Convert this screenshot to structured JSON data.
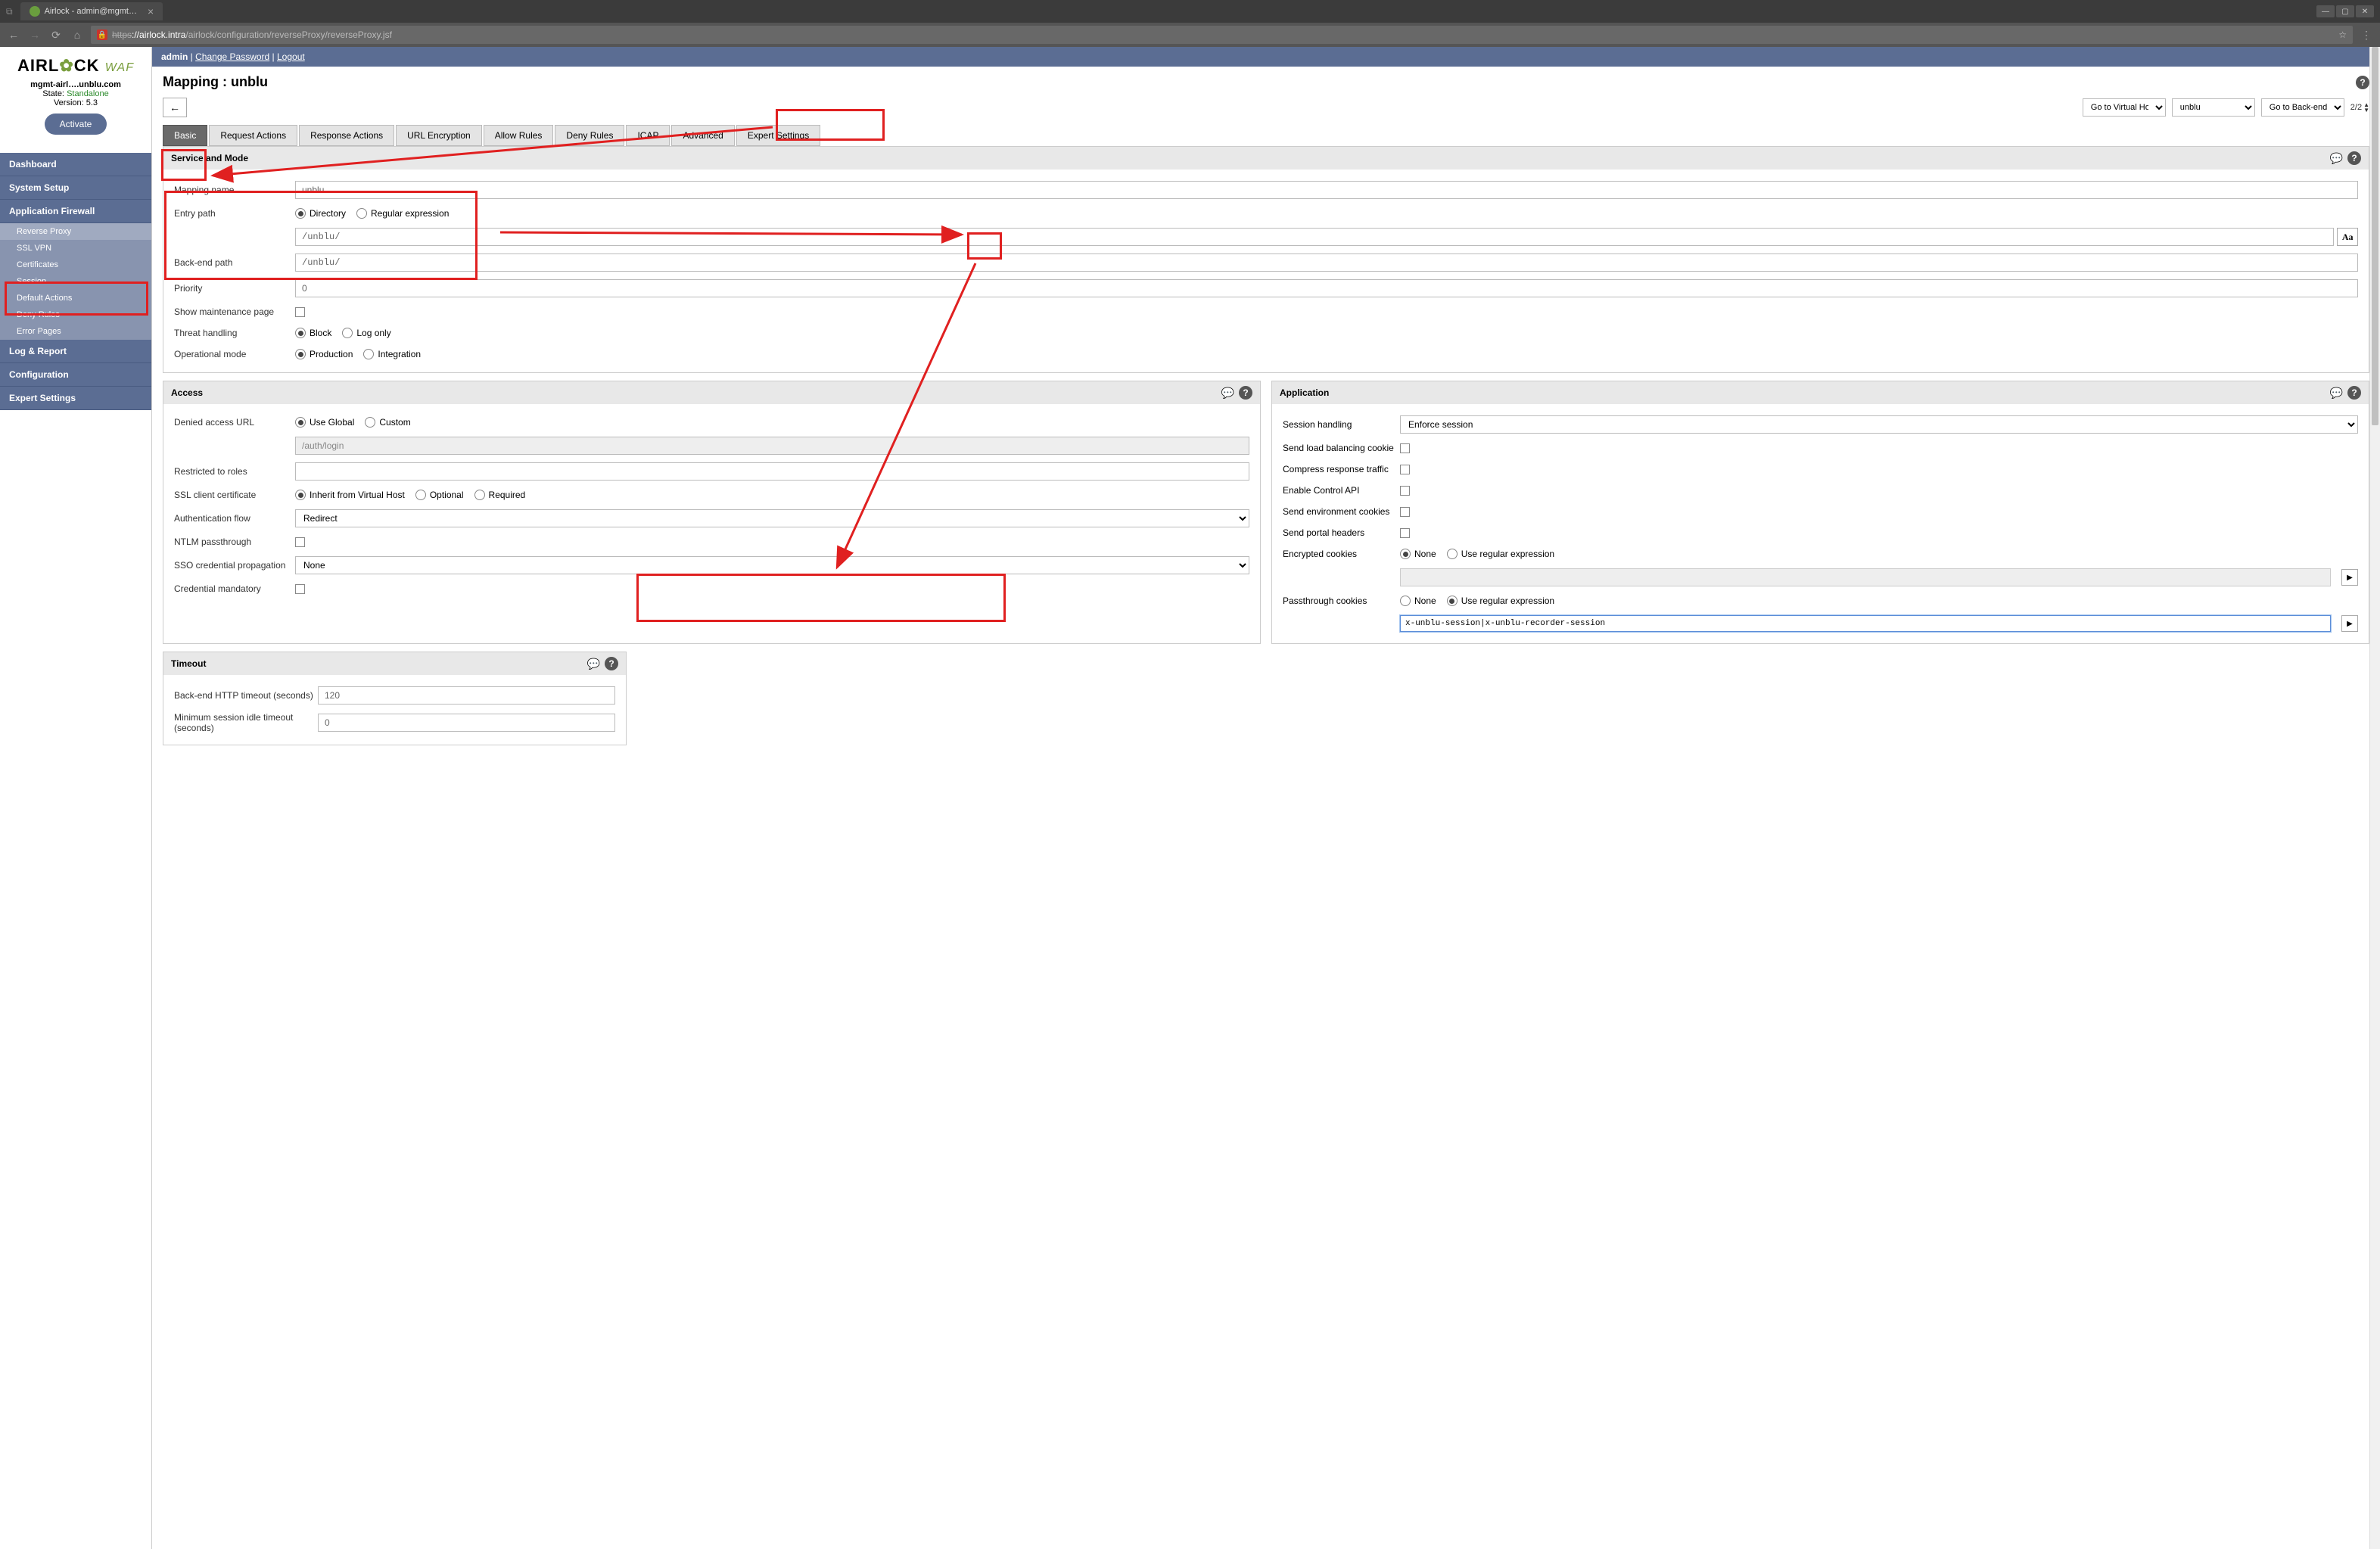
{
  "browser": {
    "tab_title": "Airlock - admin@mgmt…",
    "url_prefix": "https",
    "url_domain": "://airlock.intra",
    "url_path": "/airlock/configuration/reverseProxy/reverseProxy.jsf"
  },
  "logo": {
    "brand": "AIRL",
    "brand2": "CK",
    "waf": "WAF"
  },
  "host": {
    "name": "mgmt-airl….unblu.com",
    "state_label": "State:",
    "state_value": "Standalone",
    "version_label": "Version:",
    "version_value": "5.3"
  },
  "activate": "Activate",
  "nav": {
    "dashboard": "Dashboard",
    "system_setup": "System Setup",
    "app_firewall": "Application Firewall",
    "reverse_proxy": "Reverse Proxy",
    "ssl_vpn": "SSL VPN",
    "certificates": "Certificates",
    "session": "Session",
    "default_actions": "Default Actions",
    "deny_rules": "Deny Rules",
    "error_pages": "Error Pages",
    "log_report": "Log & Report",
    "configuration": "Configuration",
    "expert": "Expert Settings"
  },
  "topbar": {
    "user": "admin",
    "change_pw": "Change Password",
    "logout": "Logout"
  },
  "page_title": "Mapping : unblu",
  "toolbar": {
    "back": "←",
    "vh_label": "Go to Virtual Host",
    "mapping_value": "unblu",
    "bg_label": "Go to Back-end Gr",
    "pager": "2/2"
  },
  "tabs": {
    "basic": "Basic",
    "request": "Request Actions",
    "response": "Response Actions",
    "url_enc": "URL Encryption",
    "allow": "Allow Rules",
    "deny": "Deny Rules",
    "icap": "ICAP",
    "advanced": "Advanced",
    "expert": "Expert Settings"
  },
  "service": {
    "header": "Service and Mode",
    "mapping_name_label": "Mapping name",
    "mapping_name_value": "unblu",
    "entry_path_label": "Entry path",
    "directory": "Directory",
    "regex": "Regular expression",
    "entry_path_value": "/unblu/",
    "backend_label": "Back-end path",
    "backend_value": "/unblu/",
    "priority_label": "Priority",
    "priority_value": "0",
    "maintenance_label": "Show maintenance page",
    "threat_label": "Threat handling",
    "block": "Block",
    "logonly": "Log only",
    "opmode_label": "Operational mode",
    "production": "Production",
    "integration": "Integration",
    "aa": "Aa"
  },
  "access": {
    "header": "Access",
    "denied_url_label": "Denied access URL",
    "use_global": "Use Global",
    "custom": "Custom",
    "denied_url_value": "/auth/login",
    "restricted_label": "Restricted to roles",
    "ssl_label": "SSL client certificate",
    "inherit": "Inherit from Virtual Host",
    "optional": "Optional",
    "required": "Required",
    "auth_flow_label": "Authentication flow",
    "auth_flow_value": "Redirect",
    "ntlm_label": "NTLM passthrough",
    "sso_label": "SSO credential propagation",
    "sso_value": "None",
    "cred_label": "Credential mandatory"
  },
  "application": {
    "header": "Application",
    "session_label": "Session handling",
    "session_value": "Enforce session",
    "lb_cookie": "Send load balancing cookie",
    "compress": "Compress response traffic",
    "control_api": "Enable Control API",
    "env_cookies": "Send environment cookies",
    "portal": "Send portal headers",
    "enc_cookies": "Encrypted cookies",
    "none": "None",
    "use_regex": "Use regular expression",
    "passthrough": "Passthrough cookies",
    "passthrough_value": "x-unblu-session|x-unblu-recorder-session"
  },
  "timeout": {
    "header": "Timeout",
    "backend_label": "Back-end HTTP timeout (seconds)",
    "backend_value": "120",
    "idle_label": "Minimum session idle timeout (seconds)",
    "idle_value": "0"
  }
}
